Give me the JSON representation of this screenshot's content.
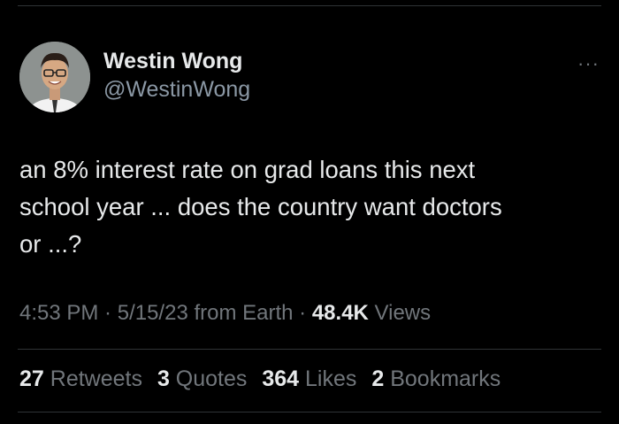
{
  "author": {
    "display_name": "Westin Wong",
    "handle": "@WestinWong"
  },
  "more_menu": "···",
  "tweet": {
    "lines": [
      "an 8% interest rate on grad loans this next",
      "school year ... does the country want doctors",
      "or ...?"
    ]
  },
  "meta": {
    "time": "4:53 PM",
    "sep1": " · ",
    "date": "5/15/23",
    "source": " from Earth",
    "sep2": " · ",
    "views_count": "48.4K",
    "views_label": " Views"
  },
  "stats": {
    "retweets": {
      "count": "27",
      "label": "Retweets"
    },
    "quotes": {
      "count": "3",
      "label": "Quotes"
    },
    "likes": {
      "count": "364",
      "label": "Likes"
    },
    "bookmarks": {
      "count": "2",
      "label": "Bookmarks"
    }
  },
  "colors": {
    "background": "#000000",
    "primary_text": "#e7e9ea",
    "secondary_text": "#71767b",
    "divider": "#2f3336"
  }
}
